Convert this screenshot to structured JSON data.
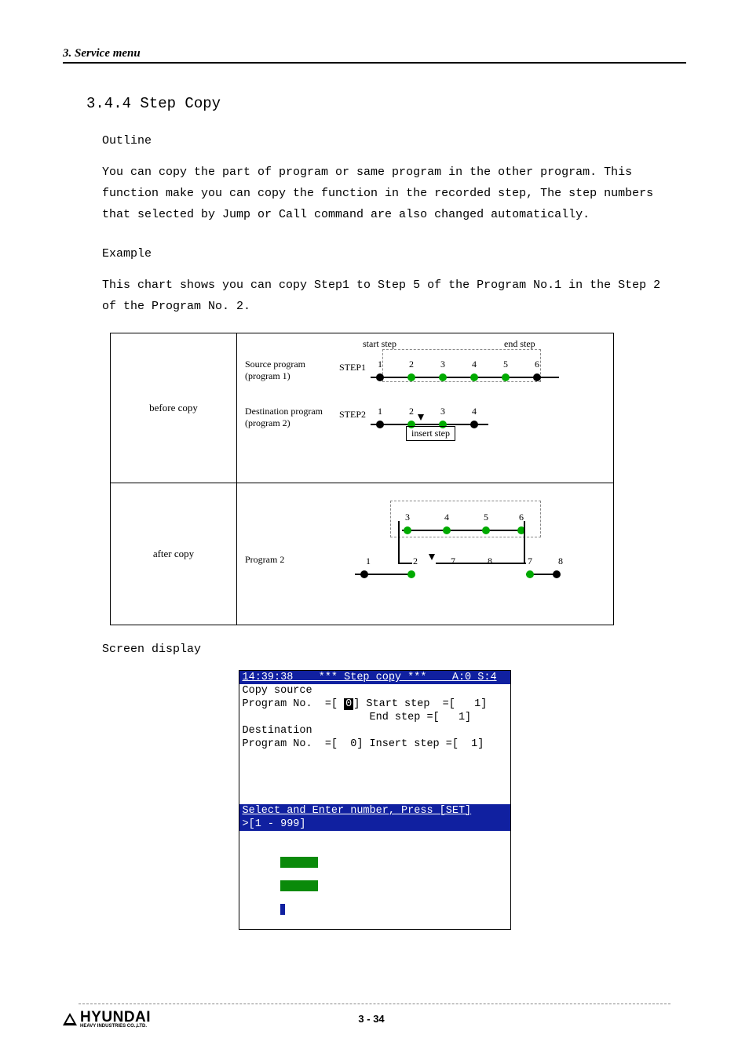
{
  "header": "3. Service menu",
  "section_title": "3.4.4 Step Copy",
  "outline_label": "Outline",
  "outline_text": "You can copy the part of program or same program in the other program. This function make you can copy the function in the recorded step, The step numbers that selected by Jump or Call command are also changed automatically.",
  "example_label": "Example",
  "example_text": "This chart shows you can copy Step1 to Step 5 of the Program No.1 in the Step 2 of the Program No. 2.",
  "diagram": {
    "before_label": "before copy",
    "after_label": "after copy",
    "source_label": "Source program\n(program 1)",
    "dest_label": "Destination program\n(program 2)",
    "program2_label": "Program 2",
    "step1_label": "STEP1",
    "step2_label": "STEP2",
    "start_step": "start step",
    "end_step": "end step",
    "insert_step": "insert step",
    "step1_nums": [
      "1",
      "2",
      "3",
      "4",
      "5",
      "6"
    ],
    "step2_nums": [
      "1",
      "2",
      "3",
      "4"
    ],
    "after_top_nums": [
      "3",
      "4",
      "5",
      "6"
    ],
    "after_bottom_nums": [
      "1",
      "2",
      "7",
      "8"
    ]
  },
  "screen_label": "Screen display",
  "screen": {
    "titlebar": "14:39:38    *** Step copy ***    A:0 S:4",
    "line1": "Copy source",
    "line2_a": "Program No.  =[ ",
    "line2_inv": "0",
    "line2_b": "] Start step  =[   1]",
    "line3": "                    End step =[   1]",
    "line4": "Destination",
    "line5": "Program No.  =[  0] Insert step =[  1]",
    "status": "Select and Enter number, Press [SET]",
    "prompt": ">[1 - 999]"
  },
  "footer": {
    "logo": "HYUNDAI",
    "logo_sub": "HEAVY INDUSTRIES CO.,LTD.",
    "page": "3 - 34"
  }
}
